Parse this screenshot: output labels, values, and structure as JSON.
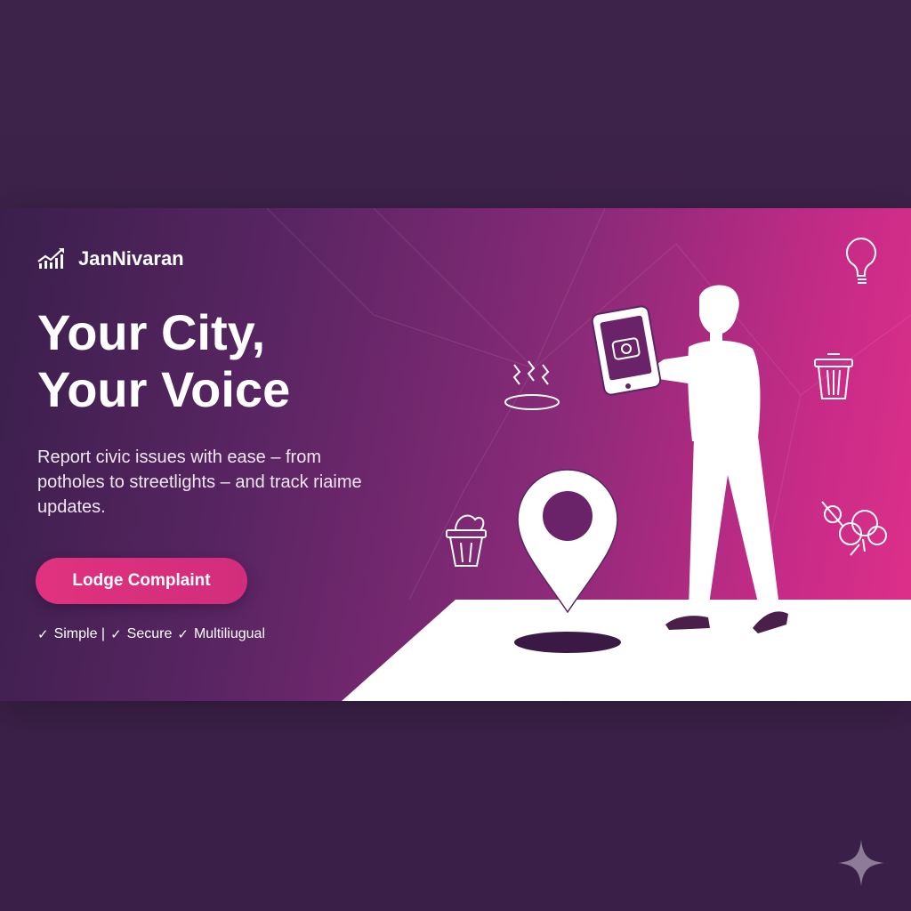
{
  "brand": {
    "name": "JanNivaran",
    "logo_icon": "chart-growth-icon"
  },
  "hero": {
    "headline_line1": "Your City,",
    "headline_line2": "Your Voice",
    "subtext": "Report civic issues with ease – from potholes to streetlights – and track riaime updates."
  },
  "cta": {
    "label": "Lodge Complaint"
  },
  "features": {
    "item1": "Simple |",
    "item2": "Secure",
    "item3": "Multiliugual",
    "check_glyph": "✓"
  },
  "icons": {
    "lightbulb": "lightbulb-icon",
    "trash": "trash-can-icon",
    "streetlight_fault": "electric-hazard-icon",
    "overflow_bin": "overflowing-bin-icon",
    "tree": "tree-icon",
    "location_pin": "location-pin-icon",
    "phone_camera": "phone-camera-icon",
    "sparkle": "sparkle-icon"
  },
  "colors": {
    "page_bg": "#3b2148",
    "banner_start": "#3a1f4c",
    "banner_end": "#e0308a",
    "accent": "#e0327f",
    "figure": "#ffffff",
    "shoe": "#4a1f4a"
  }
}
